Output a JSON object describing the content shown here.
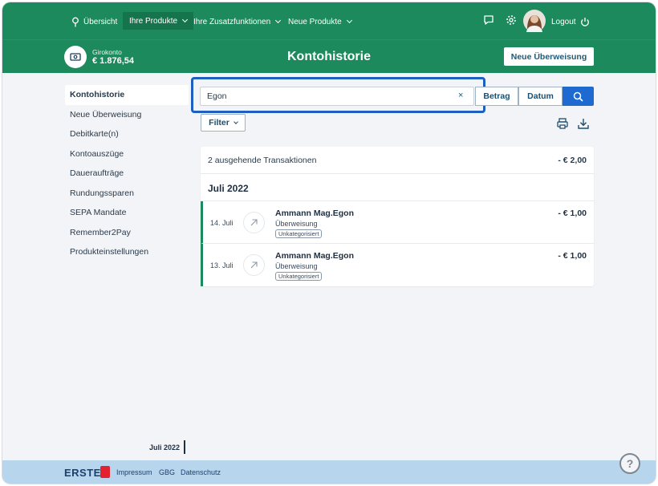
{
  "nav": {
    "overview": "Übersicht",
    "products": "Ihre Produkte",
    "extras": "Ihre Zusatzfunktionen",
    "new_products": "Neue Produkte",
    "logout": "Logout"
  },
  "account": {
    "name": "Girokonto",
    "balance": "€ 1.876,54"
  },
  "page_title": "Kontohistorie",
  "new_transfer_label": "Neue Überweisung",
  "sidebar": {
    "items": [
      {
        "label": "Kontohistorie"
      },
      {
        "label": "Neue Überweisung"
      },
      {
        "label": "Debitkarte(n)"
      },
      {
        "label": "Kontoauszüge"
      },
      {
        "label": "Daueraufträge"
      },
      {
        "label": "Rundungssparen"
      },
      {
        "label": "SEPA Mandate"
      },
      {
        "label": "Remember2Pay"
      },
      {
        "label": "Produkteinstellungen"
      }
    ]
  },
  "search": {
    "value": "Egon",
    "clear": "×",
    "amount_label": "Betrag",
    "date_label": "Datum"
  },
  "filter_label": "Filter",
  "summary": {
    "text": "2 ausgehende Transaktionen",
    "amount": "- € 2,00"
  },
  "month": "Juli 2022",
  "transactions": [
    {
      "date": "14. Juli",
      "name": "Ammann Mag.Egon",
      "type": "Überweisung",
      "tag": "Unkategorisiert",
      "amount": "- € 1,00"
    },
    {
      "date": "13. Juli",
      "name": "Ammann Mag.Egon",
      "type": "Überweisung",
      "tag": "Unkategorisiert",
      "amount": "- € 1,00"
    }
  ],
  "timeline_label": "Juli 2022",
  "footer": {
    "logo": "ERSTE",
    "links": [
      "Impressum",
      "GBG",
      "Datenschutz"
    ]
  },
  "help": "?",
  "colors": {
    "brand_green": "#1c8a5c",
    "accent_blue": "#1e6ad1",
    "footer_blue": "#b7d6ee",
    "logo_red": "#e4212f"
  }
}
